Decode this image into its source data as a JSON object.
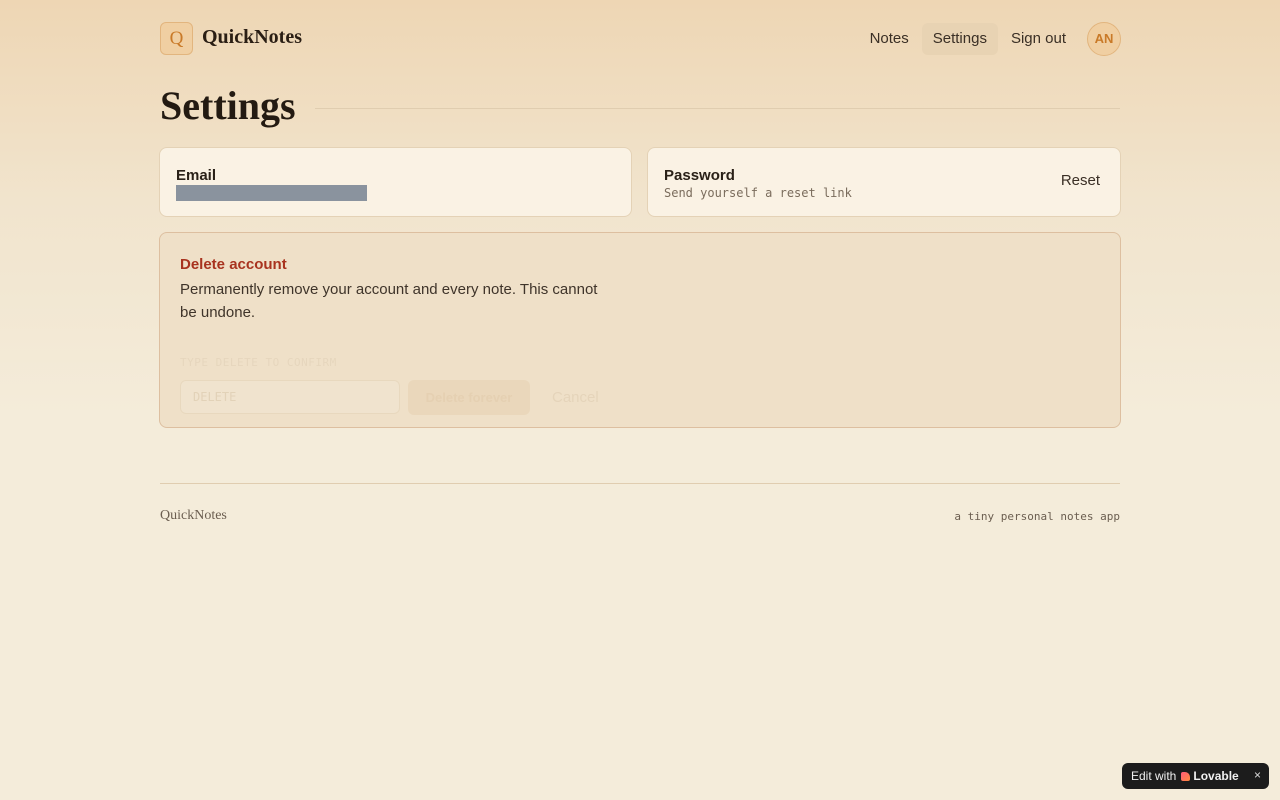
{
  "app": {
    "logo_letter": "Q",
    "name": "QuickNotes"
  },
  "nav": {
    "items": [
      {
        "label": "Notes"
      },
      {
        "label": "Settings"
      },
      {
        "label": "Sign out"
      }
    ],
    "avatar_initials": "AN"
  },
  "page": {
    "title": "Settings"
  },
  "email_card": {
    "label": "Email"
  },
  "password_card": {
    "label": "Password",
    "hint": "Send yourself a reset link",
    "action_label": "Reset"
  },
  "danger_zone": {
    "title": "Delete account",
    "description": "Permanently remove your account and every note. This cannot be undone.",
    "confirm_label": "TYPE DELETE TO CONFIRM",
    "confirm_placeholder": "DELETE",
    "delete_button": "Delete forever",
    "cancel_button": "Cancel"
  },
  "footer": {
    "brand": "QuickNotes",
    "tagline": "a tiny personal notes app"
  },
  "badge": {
    "prefix": "Edit with",
    "brand": "Lovable",
    "close": "×"
  },
  "colors": {
    "accent": "#c97a28",
    "danger": "#a8331f",
    "background": "#f4ecda"
  }
}
